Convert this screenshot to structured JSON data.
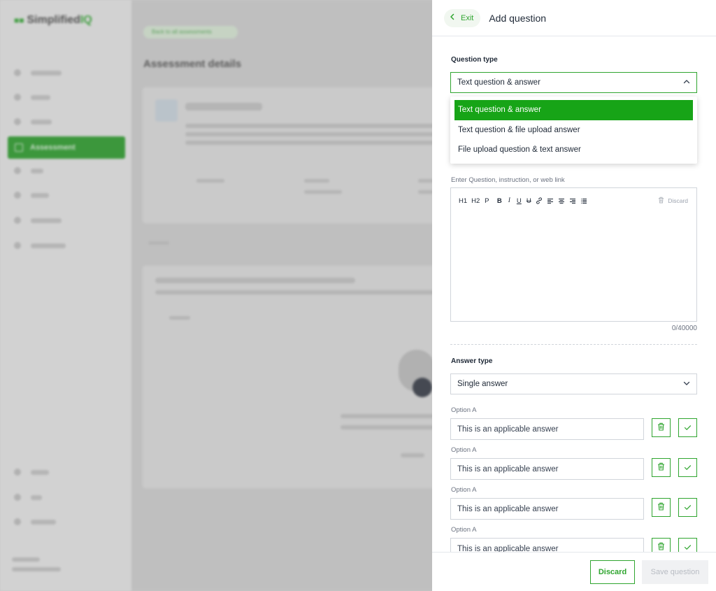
{
  "colors": {
    "accent": "#2fa52f",
    "selected_bg": "#17a417",
    "border": "#d1d5db"
  },
  "background_app": {
    "logo_text": "Simplified",
    "logo_accent": "IQ",
    "active_nav_label": "Assessment",
    "back_link": "Back to all assessments",
    "page_title": "Assessment details"
  },
  "header": {
    "exit_label": "Exit",
    "title": "Add question"
  },
  "question_type": {
    "label": "Question type",
    "selected": "Text question & answer",
    "options": [
      "Text question & answer",
      "Text question & file upload answer",
      "File upload question & text answer"
    ]
  },
  "editor": {
    "hint": "Enter Question, instruction, or web link",
    "toolbar": {
      "h1": "H1",
      "h2": "H2",
      "p": "P",
      "bold": "B",
      "italic": "I",
      "underline": "U",
      "strike": "U"
    },
    "discard_label": "Discard",
    "counter": "0/40000"
  },
  "answer_type": {
    "label": "Answer type",
    "selected": "Single answer"
  },
  "options": [
    {
      "label": "Option A",
      "value": "This is an applicable answer"
    },
    {
      "label": "Option A",
      "value": "This is an applicable answer"
    },
    {
      "label": "Option A",
      "value": "This is an applicable answer"
    },
    {
      "label": "Option A",
      "value": "This is an applicable answer"
    }
  ],
  "footer": {
    "discard_label": "Discard",
    "save_label": "Save question"
  }
}
